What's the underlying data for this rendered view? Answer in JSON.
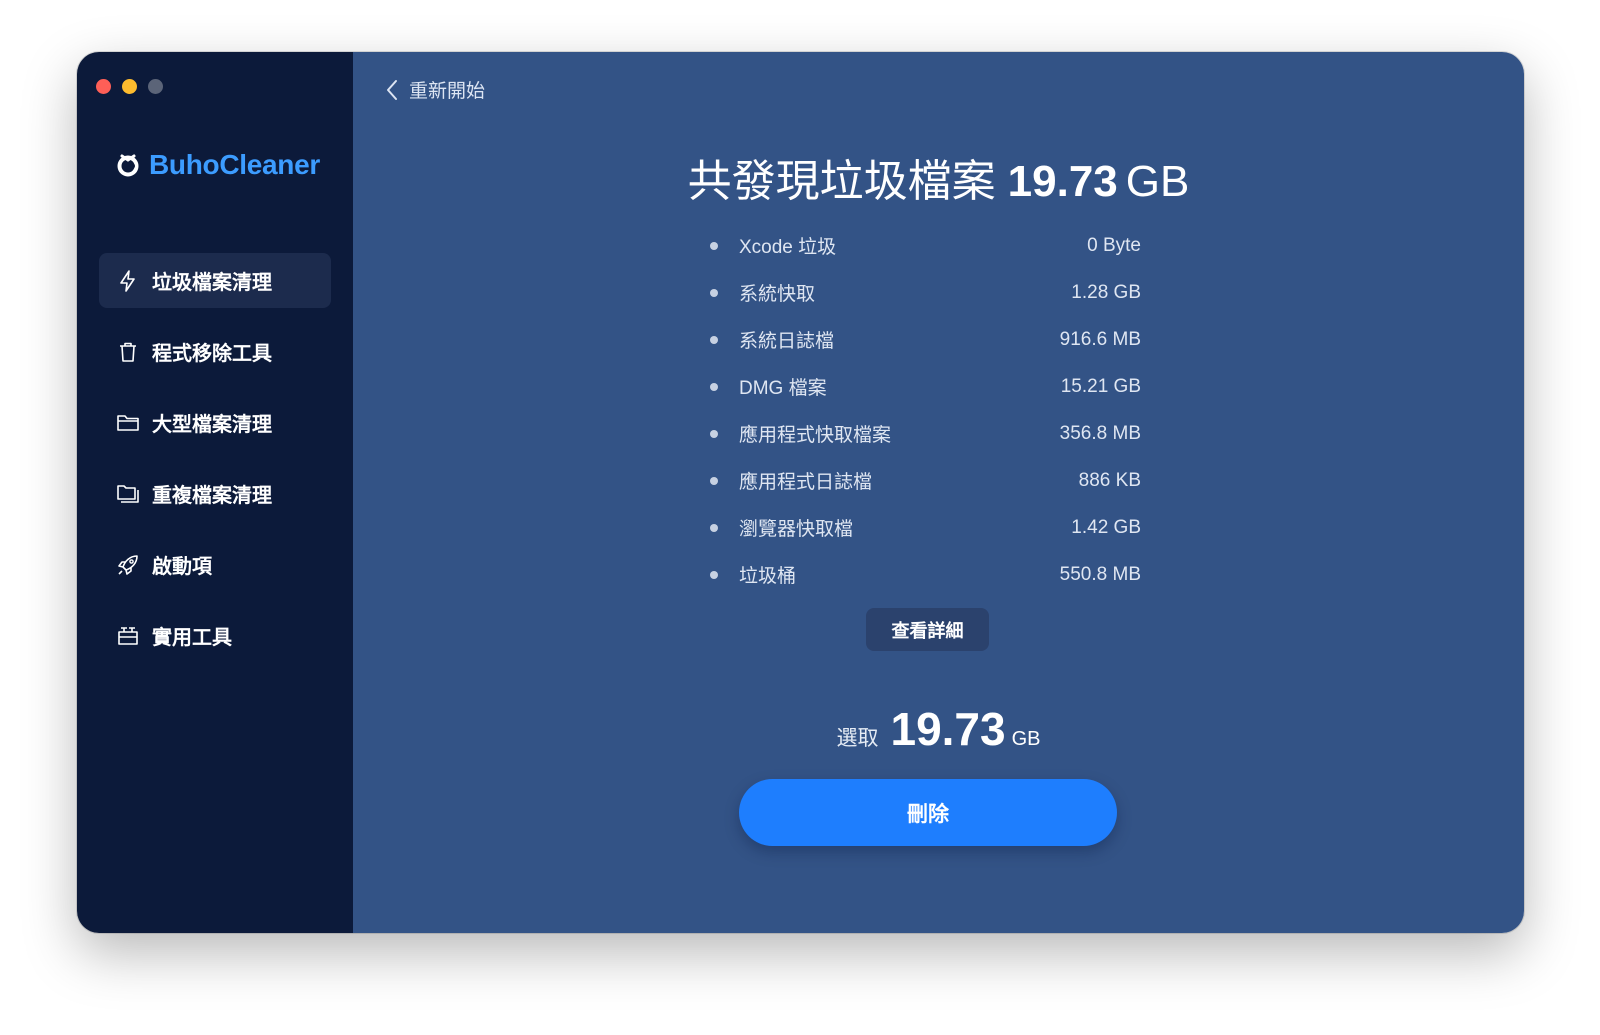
{
  "app": {
    "name": "BuhoCleaner"
  },
  "sidebar": {
    "items": [
      {
        "label": "垃圾檔案清理",
        "icon": "lightning-icon",
        "active": true
      },
      {
        "label": "程式移除工具",
        "icon": "trash-icon",
        "active": false
      },
      {
        "label": "大型檔案清理",
        "icon": "folder-icon",
        "active": false
      },
      {
        "label": "重複檔案清理",
        "icon": "duplicate-folder-icon",
        "active": false
      },
      {
        "label": "啟動項",
        "icon": "rocket-icon",
        "active": false
      },
      {
        "label": "實用工具",
        "icon": "toolbox-icon",
        "active": false
      }
    ]
  },
  "main": {
    "back_label": "重新開始",
    "headline": {
      "prefix": "共發現垃圾檔案",
      "value": "19.73",
      "unit": "GB"
    },
    "items": [
      {
        "label": "Xcode 垃圾",
        "size": "0 Byte"
      },
      {
        "label": "系統快取",
        "size": "1.28 GB"
      },
      {
        "label": "系統日誌檔",
        "size": "916.6 MB"
      },
      {
        "label": "DMG 檔案",
        "size": "15.21 GB"
      },
      {
        "label": "應用程式快取檔案",
        "size": "356.8 MB"
      },
      {
        "label": "應用程式日誌檔",
        "size": "886 KB"
      },
      {
        "label": "瀏覽器快取檔",
        "size": "1.42 GB"
      },
      {
        "label": "垃圾桶",
        "size": "550.8 MB"
      }
    ],
    "details_label": "查看詳細",
    "selected": {
      "label": "選取",
      "value": "19.73",
      "unit": "GB"
    },
    "delete_label": "刪除"
  },
  "colors": {
    "sidebar_bg": "#0c1a3a",
    "main_bg": "#335386",
    "brand": "#3c9cff",
    "accent_button": "#1e7efe"
  }
}
